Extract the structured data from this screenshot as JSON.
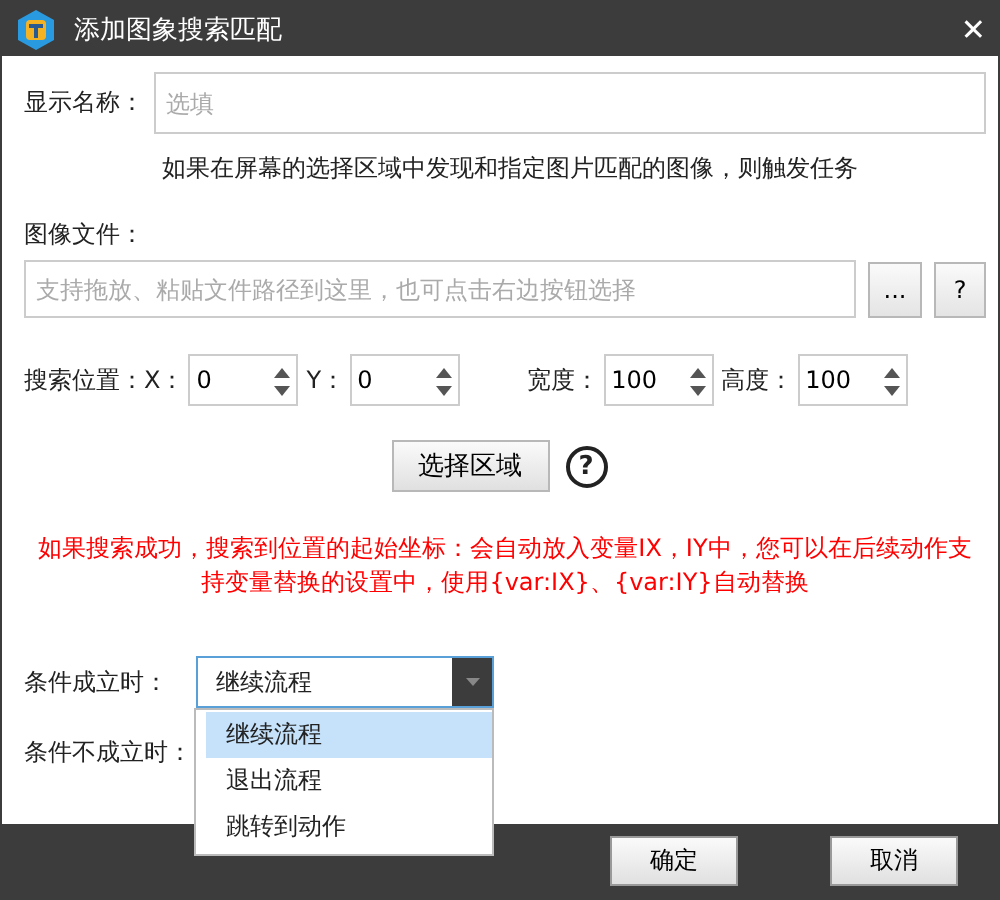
{
  "window": {
    "title": "添加图象搜索匹配",
    "close": "✕"
  },
  "name_field": {
    "label": "显示名称：",
    "placeholder": "选填"
  },
  "hint": "如果在屏幕的选择区域中发现和指定图片匹配的图像，则触发任务",
  "file": {
    "label": "图像文件：",
    "placeholder": "支持拖放、粘贴文件路径到这里，也可点击右边按钮选择",
    "browse": "...",
    "help": "?"
  },
  "position": {
    "label": "搜索位置：",
    "fields": [
      {
        "label": "X：",
        "value": "0"
      },
      {
        "label": "Y：",
        "value": "0"
      },
      {
        "label": "宽度：",
        "value": "100"
      },
      {
        "label": "高度：",
        "value": "100"
      }
    ]
  },
  "select_area": {
    "button": "选择区域",
    "help": "?"
  },
  "warning": "如果搜索成功，搜索到位置的起始坐标：会自动放入变量IX，IY中，您可以在后续动作支持变量替换的设置中，使用{var:IX}、{var:IY}自动替换",
  "on_success": {
    "label": "条件成立时：",
    "value": "继续流程",
    "expanded": true,
    "options": [
      {
        "label": "继续流程",
        "selected": true
      },
      {
        "label": "退出流程",
        "selected": false
      },
      {
        "label": "跳转到动作",
        "selected": false
      }
    ]
  },
  "on_failure": {
    "label": "条件不成立时："
  },
  "buttons": [
    "确定",
    "取消"
  ]
}
